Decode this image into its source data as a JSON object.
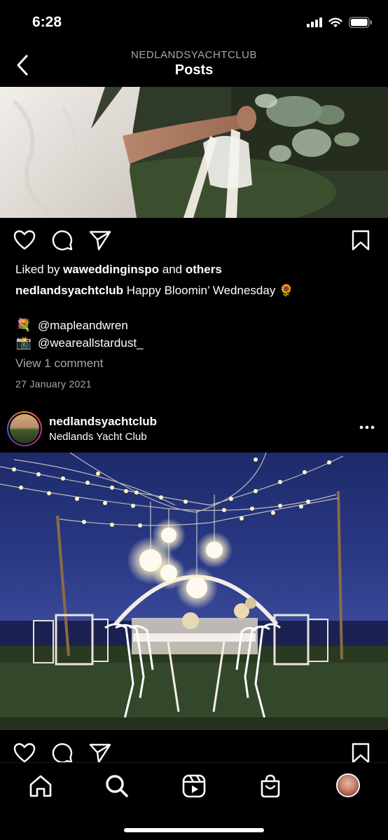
{
  "status_bar": {
    "time": "6:28"
  },
  "header": {
    "account": "NEDLANDSYACHTCLUB",
    "title": "Posts"
  },
  "post1": {
    "likes_prefix": "Liked by",
    "liked_by_user": "waweddinginspo",
    "likes_joiner": "and",
    "likes_others": "others",
    "caption_user": "nedlandsyachtclub",
    "caption_text": "Happy Bloomin’ Wednesday 🌻",
    "mentions": [
      {
        "emoji": "💐",
        "handle": "@mapleandwren"
      },
      {
        "emoji": "📸",
        "handle": "@weareallstardust_"
      }
    ],
    "view_comments": "View 1 comment",
    "date": "27 January 2021"
  },
  "post2": {
    "username": "nedlandsyachtclub",
    "location": "Nedlands Yacht Club"
  },
  "icons": {
    "like": "heart-icon",
    "comment": "comment-icon",
    "share": "paper-plane-icon",
    "save": "bookmark-icon",
    "more": "more-dots-icon",
    "nav": [
      "home-icon",
      "search-icon",
      "reels-icon",
      "shop-icon",
      "profile-avatar"
    ]
  },
  "colors": {
    "background": "#000000",
    "text": "#ffffff",
    "secondary_text": "#a8a8a8"
  }
}
